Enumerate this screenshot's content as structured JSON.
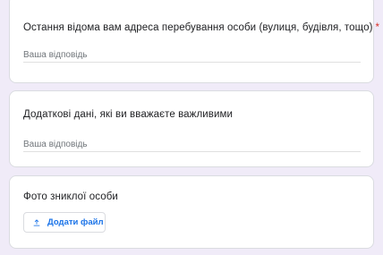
{
  "form": {
    "questions": [
      {
        "title": "Остання відома вам адреса перебування особи (вулиця, будівля, тощо)",
        "required_mark": "*",
        "answer_placeholder": "Ваша відповідь"
      },
      {
        "title": "Додаткові дані, які ви вважаєте важливими",
        "answer_placeholder": "Ваша відповідь"
      },
      {
        "title": "Фото зниклої особи",
        "upload_label": "Додати файл",
        "upload_icon": "upload-icon"
      }
    ]
  },
  "colors": {
    "background": "#f0ebf8",
    "accent": "#1a73e8",
    "required": "#d93025"
  }
}
